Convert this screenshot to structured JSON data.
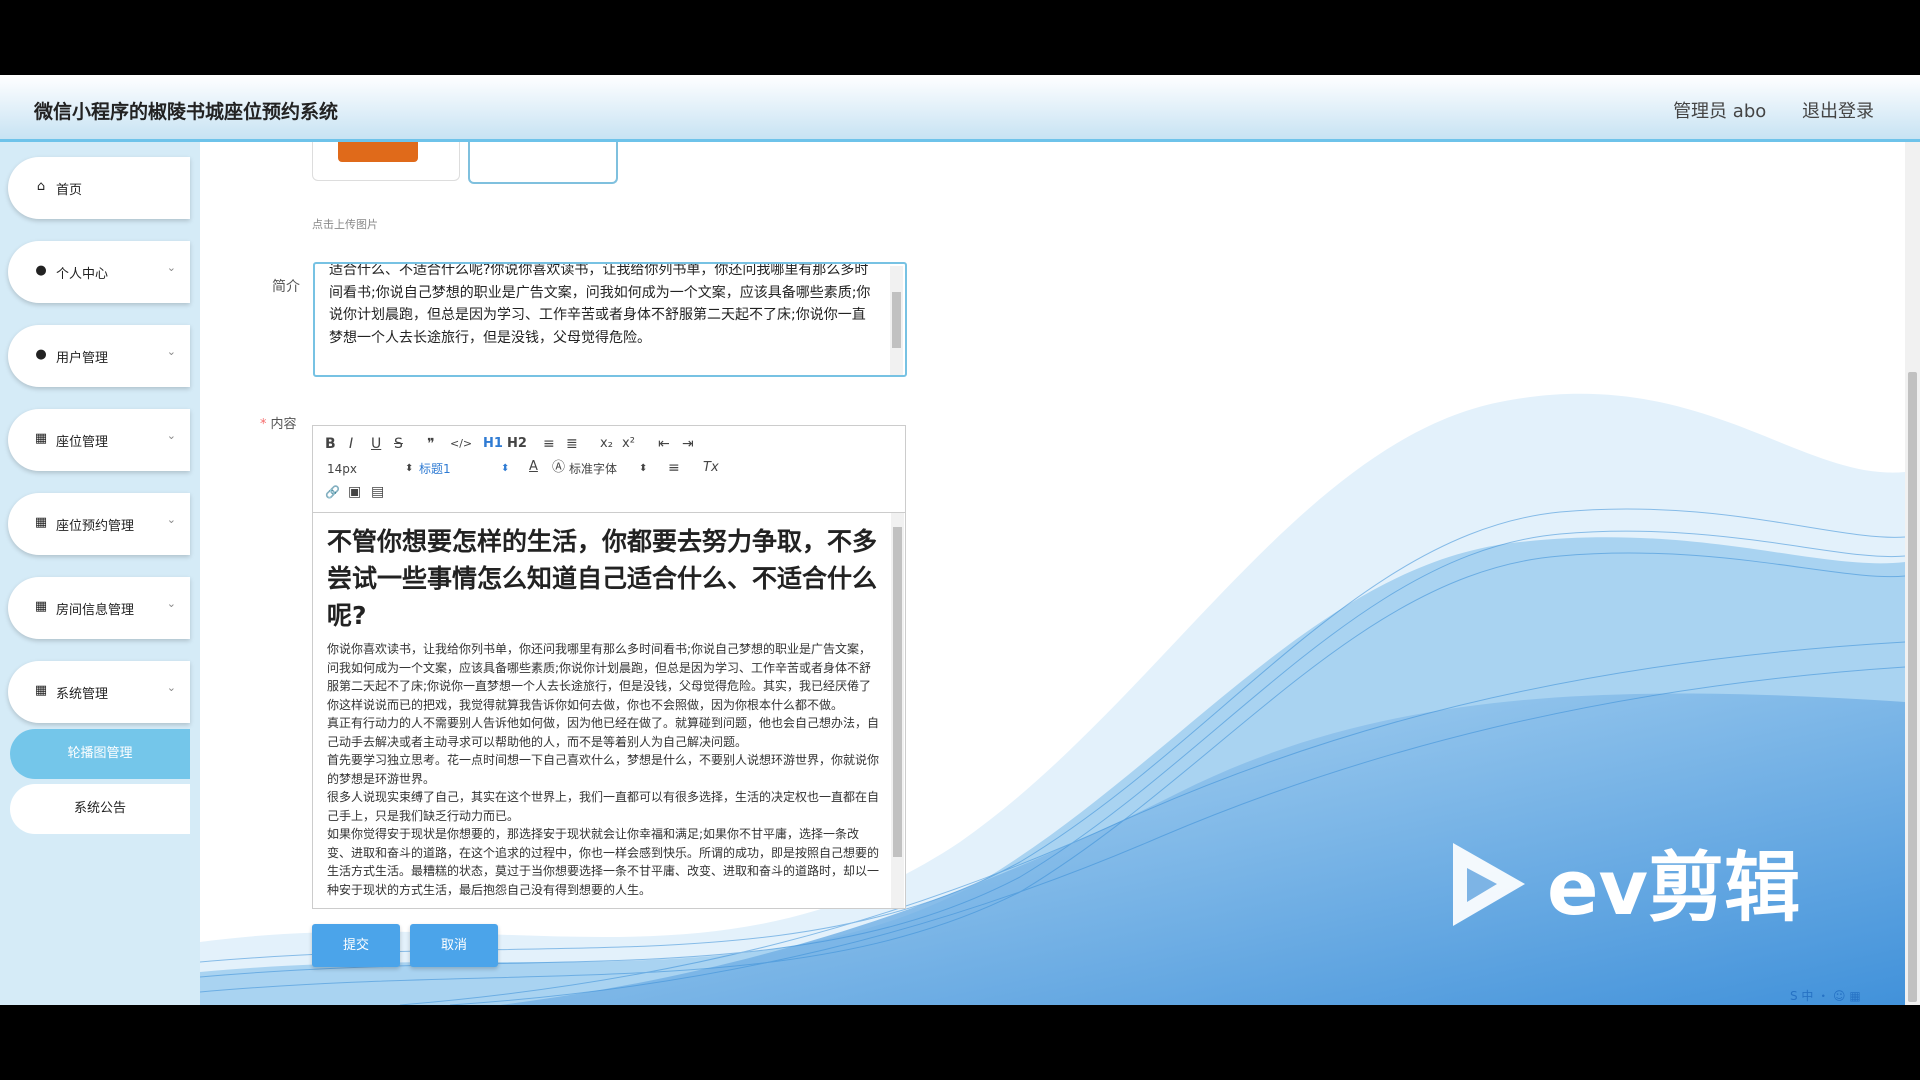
{
  "header": {
    "title": "微信小程序的椒陵书城座位预约系统",
    "user": "管理员 abo",
    "logout": "退出登录"
  },
  "sidebar": {
    "items": [
      {
        "label": "首页",
        "icon": "home-icon",
        "glyph": "⌂"
      },
      {
        "label": "个人中心",
        "icon": "user-icon",
        "glyph": "●"
      },
      {
        "label": "用户管理",
        "icon": "location-icon",
        "glyph": "●"
      },
      {
        "label": "座位管理",
        "icon": "grid-icon",
        "glyph": "▦"
      },
      {
        "label": "座位预约管理",
        "icon": "grid-icon",
        "glyph": "▦"
      },
      {
        "label": "房间信息管理",
        "icon": "grid-icon",
        "glyph": "▦"
      },
      {
        "label": "系统管理",
        "icon": "grid-icon",
        "glyph": "▦"
      }
    ],
    "subitems": [
      {
        "label": "轮播图管理",
        "active": true
      },
      {
        "label": "系统公告",
        "active": false
      }
    ],
    "chevron": "⌄"
  },
  "form": {
    "upload_hint": "点击上传图片",
    "intro_label": "简介",
    "intro_text": "适合什么、不适合什么呢?你说你喜欢读书，让我给你列书单，你还问我哪里有那么多时间看书;你说自己梦想的职业是广告文案，问我如何成为一个文案，应该具备哪些素质;你说你计划晨跑，但总是因为学习、工作辛苦或者身体不舒服第二天起不了床;你说你一直梦想一个人去长途旅行，但是没钱，父母觉得危险。",
    "content_label": "内容",
    "required_mark": "*",
    "submit": "提交",
    "cancel": "取消"
  },
  "editor": {
    "toolbar": {
      "font_size": "14px",
      "heading": "标题1",
      "font_family": "标准字体",
      "buttons": [
        "B",
        "I",
        "U",
        "S",
        "❞",
        "</>",
        "H1",
        "H2",
        "≡",
        "≣",
        "x₂",
        "x²",
        "⇤",
        "⇥",
        "A",
        "Ⓐ",
        "≡",
        "Tx",
        "🔗",
        "▣",
        "▤"
      ]
    },
    "heading": "不管你想要怎样的生活，你都要去努力争取，不多尝试一些事情怎么知道自己适合什么、不适合什么呢?",
    "paragraphs": [
      "你说你喜欢读书，让我给你列书单，你还问我哪里有那么多时间看书;你说自己梦想的职业是广告文案，问我如何成为一个文案，应该具备哪些素质;你说你计划晨跑，但总是因为学习、工作辛苦或者身体不舒服第二天起不了床;你说你一直梦想一个人去长途旅行，但是没钱，父母觉得危险。其实，我已经厌倦了你这样说说而已的把戏，我觉得就算我告诉你如何去做，你也不会照做，因为你根本什么都不做。",
      "真正有行动力的人不需要别人告诉他如何做，因为他已经在做了。就算碰到问题，他也会自己想办法，自己动手去解决或者主动寻求可以帮助他的人，而不是等着别人为自己解决问题。",
      "首先要学习独立思考。花一点时间想一下自己喜欢什么，梦想是什么，不要别人说想环游世界，你就说你的梦想是环游世界。",
      "很多人说现实束缚了自己，其实在这个世界上，我们一直都可以有很多选择，生活的决定权也一直都在自己手上，只是我们缺乏行动力而已。",
      "如果你觉得安于现状是你想要的，那选择安于现状就会让你幸福和满足;如果你不甘平庸，选择一条改变、进取和奋斗的道路，在这个追求的过程中，你也一样会感到快乐。所谓的成功，即是按照自己想要的生活方式生活。最糟糕的状态，莫过于当你想要选择一条不甘平庸、改变、进取和奋斗的道路时，却以一种安于现状的方式生活，最后抱怨自己没有得到想要的人生。"
    ]
  },
  "watermark": {
    "text": "ev剪辑"
  },
  "tray": {
    "text": "S 中 ・ ☺ ▦"
  },
  "colors": {
    "accent": "#4ba4ea",
    "sidebar_bg": "#d5ebf7",
    "active": "#74c6ea",
    "header_border": "#6ec3ea"
  }
}
